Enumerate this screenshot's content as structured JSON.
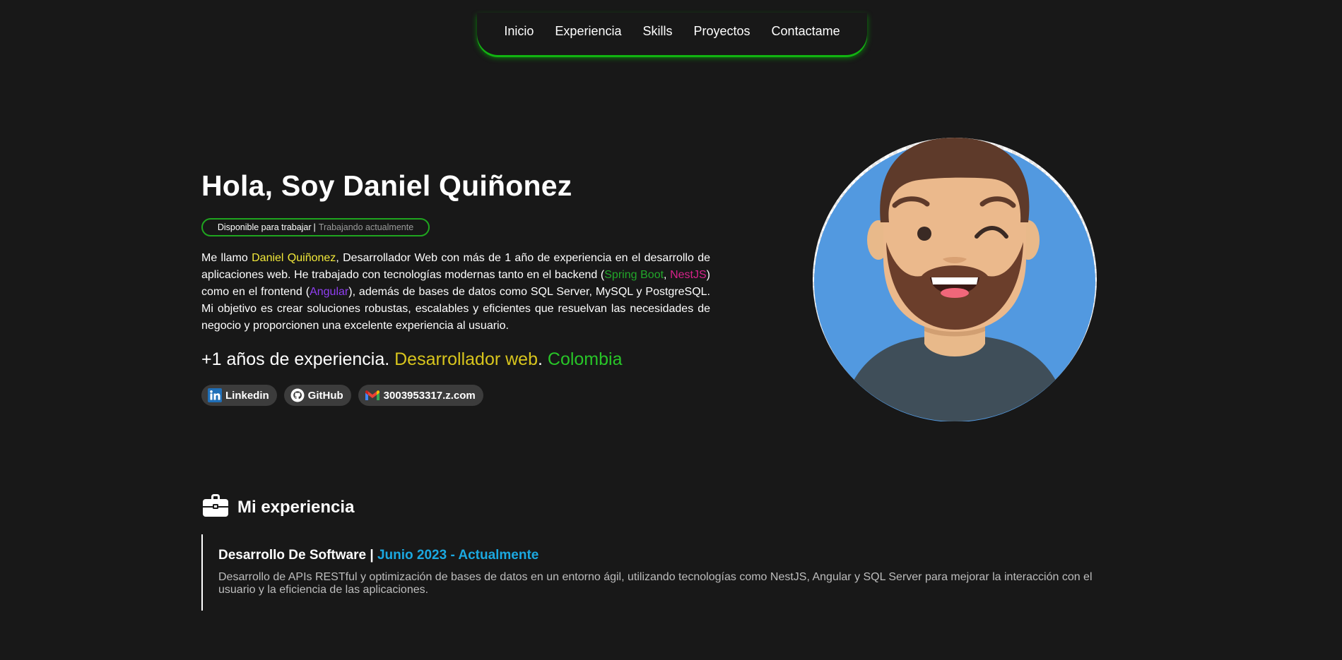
{
  "nav": {
    "items": [
      "Inicio",
      "Experiencia",
      "Skills",
      "Proyectos",
      "Contactame"
    ]
  },
  "hero": {
    "title": "Hola, Soy Daniel Quiñonez",
    "badge": {
      "status": "Disponible para trabajar",
      "separator": "|",
      "detail": "Trabajando actualmente"
    },
    "bio": {
      "p1": "Me llamo ",
      "name": "Daniel Quiñonez",
      "p2": ", Desarrollador Web con más de 1 año de experiencia en el desarrollo de aplicaciones web. He trabajado con tecnologías modernas tanto en el backend (",
      "tech1": "Spring Boot",
      "p3": ", ",
      "tech2": "NestJS",
      "p4": ") como en el frontend (",
      "tech3": "Angular",
      "p5": "), además de bases de datos como SQL Server, MySQL y PostgreSQL. Mi objetivo es crear soluciones robustas, escalables y eficientes que resuelvan las necesidades de negocio y proporcionen una excelente experiencia al usuario."
    },
    "tagline": {
      "part1": "+1 años de experiencia. ",
      "part2": "Desarrollador web",
      "dot": ". ",
      "part3": "Colombia"
    },
    "links": [
      {
        "label": "Linkedin",
        "icon": "linkedin-icon"
      },
      {
        "label": "GitHub",
        "icon": "github-icon"
      },
      {
        "label": "3003953317.z.com",
        "icon": "gmail-icon"
      }
    ]
  },
  "experience": {
    "heading": "Mi experiencia",
    "icon": "briefcase-icon",
    "items": [
      {
        "role": "Desarrollo De Software",
        "separator": " | ",
        "period": "Junio 2023 - Actualmente",
        "description": "Desarrollo de APIs RESTful y optimización de bases de datos en un entorno ágil, utilizando tecnologías como NestJS, Angular y SQL Server para mejorar la interacción con el usuario y la eficiencia de las aplicaciones."
      }
    ]
  },
  "colors": {
    "background": "#181818",
    "nav_glow": "#1fa51f",
    "highlight_yellow": "#f2e93a",
    "highlight_green": "#22a82a",
    "highlight_pink": "#d6228a",
    "highlight_purple": "#8f3ef0",
    "date_blue": "#1ba8e0",
    "avatar_bg": "#5299e0"
  }
}
